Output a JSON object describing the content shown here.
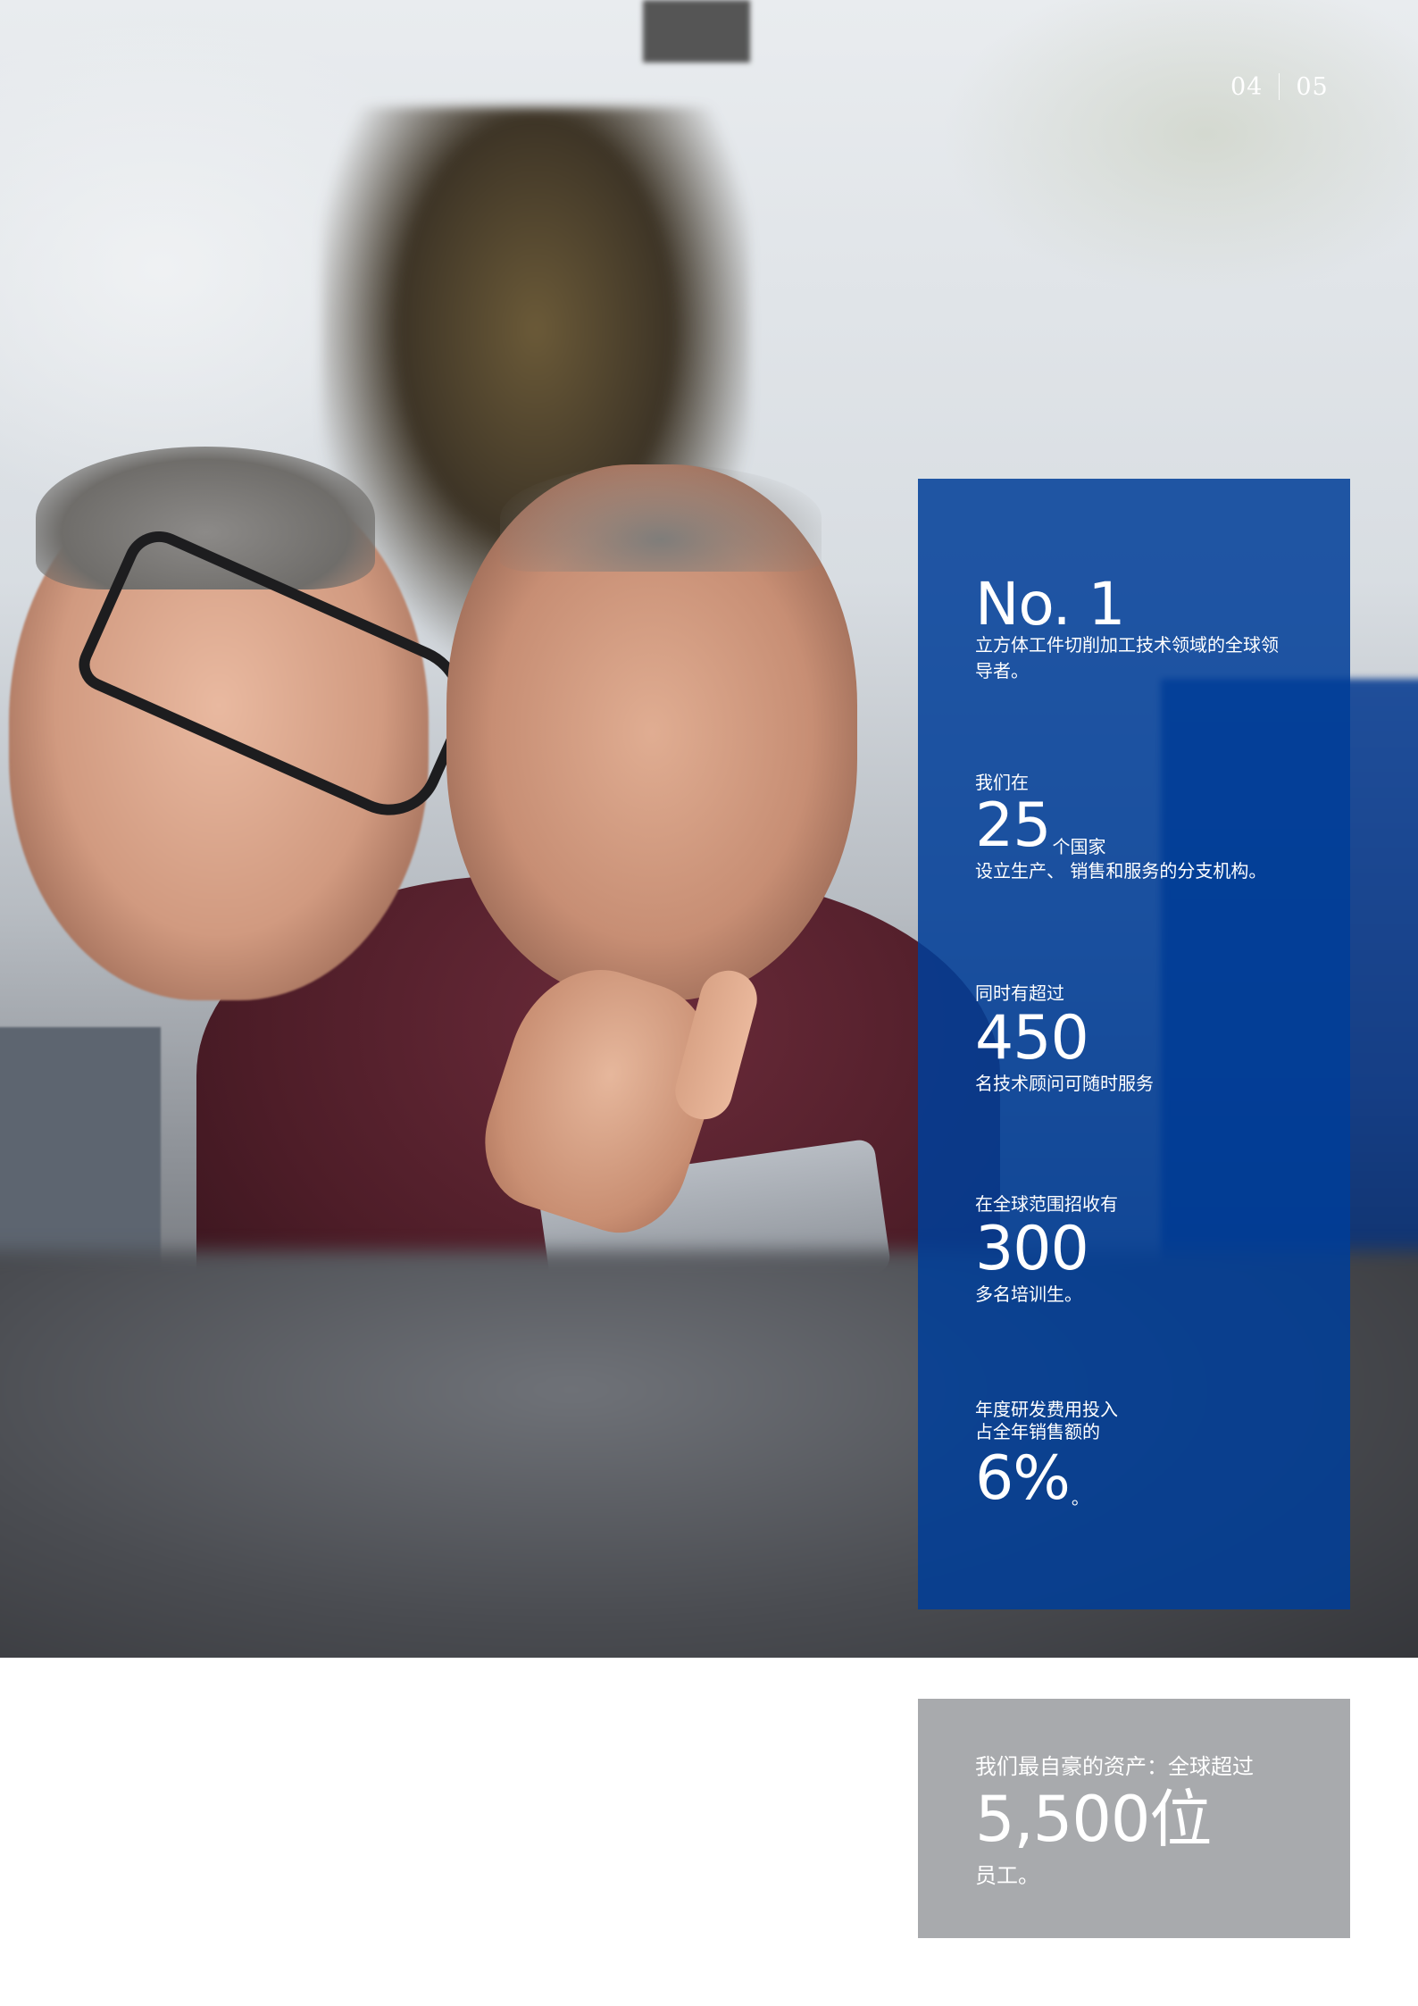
{
  "page_numbers": {
    "left": "04",
    "right": "05"
  },
  "stats": {
    "s1": {
      "headline": "No. 1",
      "desc": "立方体工件切削加工技术领域的全球领导者。"
    },
    "s2": {
      "pre": "我们在",
      "number": "25",
      "unit": "个国家",
      "post": "设立生产、 销售和服务的分支机构。"
    },
    "s3": {
      "pre": "同时有超过",
      "number": "450",
      "post": "名技术顾问可随时服务"
    },
    "s4": {
      "pre": "在全球范围招收有",
      "number": "300",
      "post": "多名培训生。"
    },
    "s5": {
      "pre_line1": "年度研发费用投入",
      "pre_line2": "占全年销售额的",
      "number": "6%",
      "suffix": "。"
    }
  },
  "assets": {
    "intro": "我们最自豪的资产：全球超过",
    "value": "5,500位",
    "outro": "员工。"
  },
  "colors": {
    "panel_blue": "#003e99",
    "panel_gray": "#a8aaad"
  }
}
